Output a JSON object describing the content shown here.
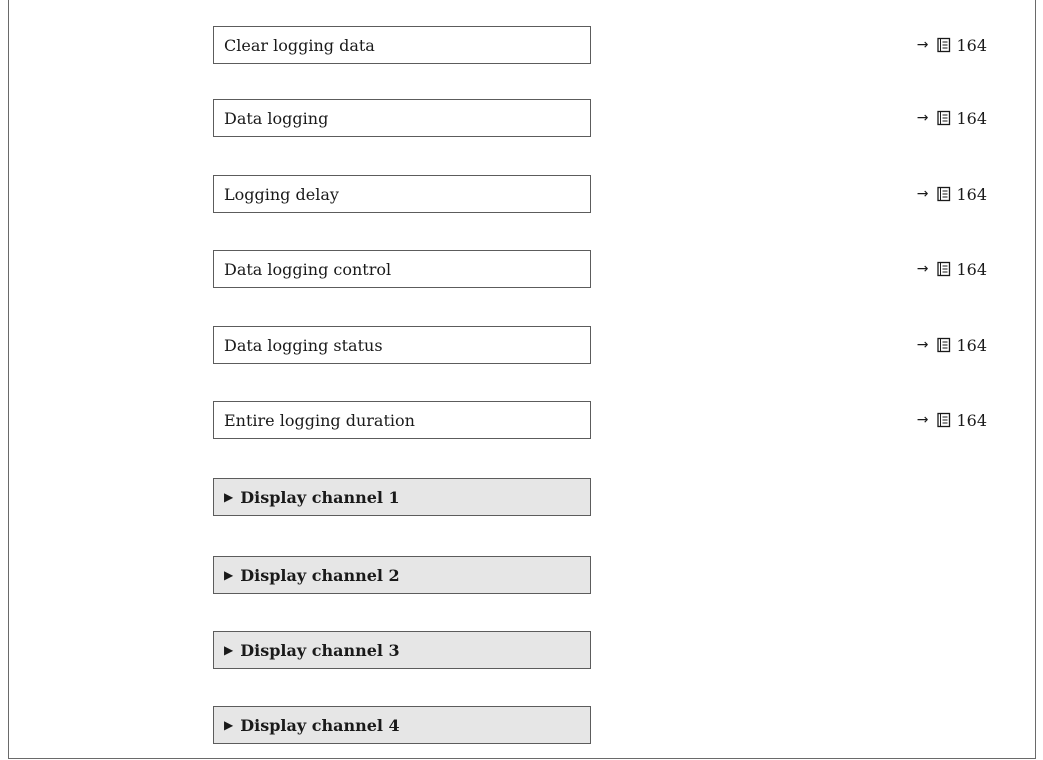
{
  "parameters": [
    {
      "label": "Clear logging data",
      "ref_arrow": "→",
      "page_ref": "164"
    },
    {
      "label": "Data logging",
      "ref_arrow": "→",
      "page_ref": "164"
    },
    {
      "label": "Logging delay",
      "ref_arrow": "→",
      "page_ref": "164"
    },
    {
      "label": "Data logging control",
      "ref_arrow": "→",
      "page_ref": "164"
    },
    {
      "label": "Data logging status",
      "ref_arrow": "→",
      "page_ref": "164"
    },
    {
      "label": "Entire logging duration",
      "ref_arrow": "→",
      "page_ref": "164"
    }
  ],
  "submenus": [
    {
      "marker": "▶",
      "label": "Display channel 1"
    },
    {
      "marker": "▶",
      "label": "Display channel 2"
    },
    {
      "marker": "▶",
      "label": "Display channel 3"
    },
    {
      "marker": "▶",
      "label": "Display channel 4"
    }
  ],
  "icons": {
    "page_reference": "book-icon",
    "submenu_marker": "triangle-right-icon"
  },
  "colors": {
    "submenu_background": "#e6e6e6",
    "box_border": "#5c5c5c",
    "frame_border": "#6a6a6a"
  }
}
